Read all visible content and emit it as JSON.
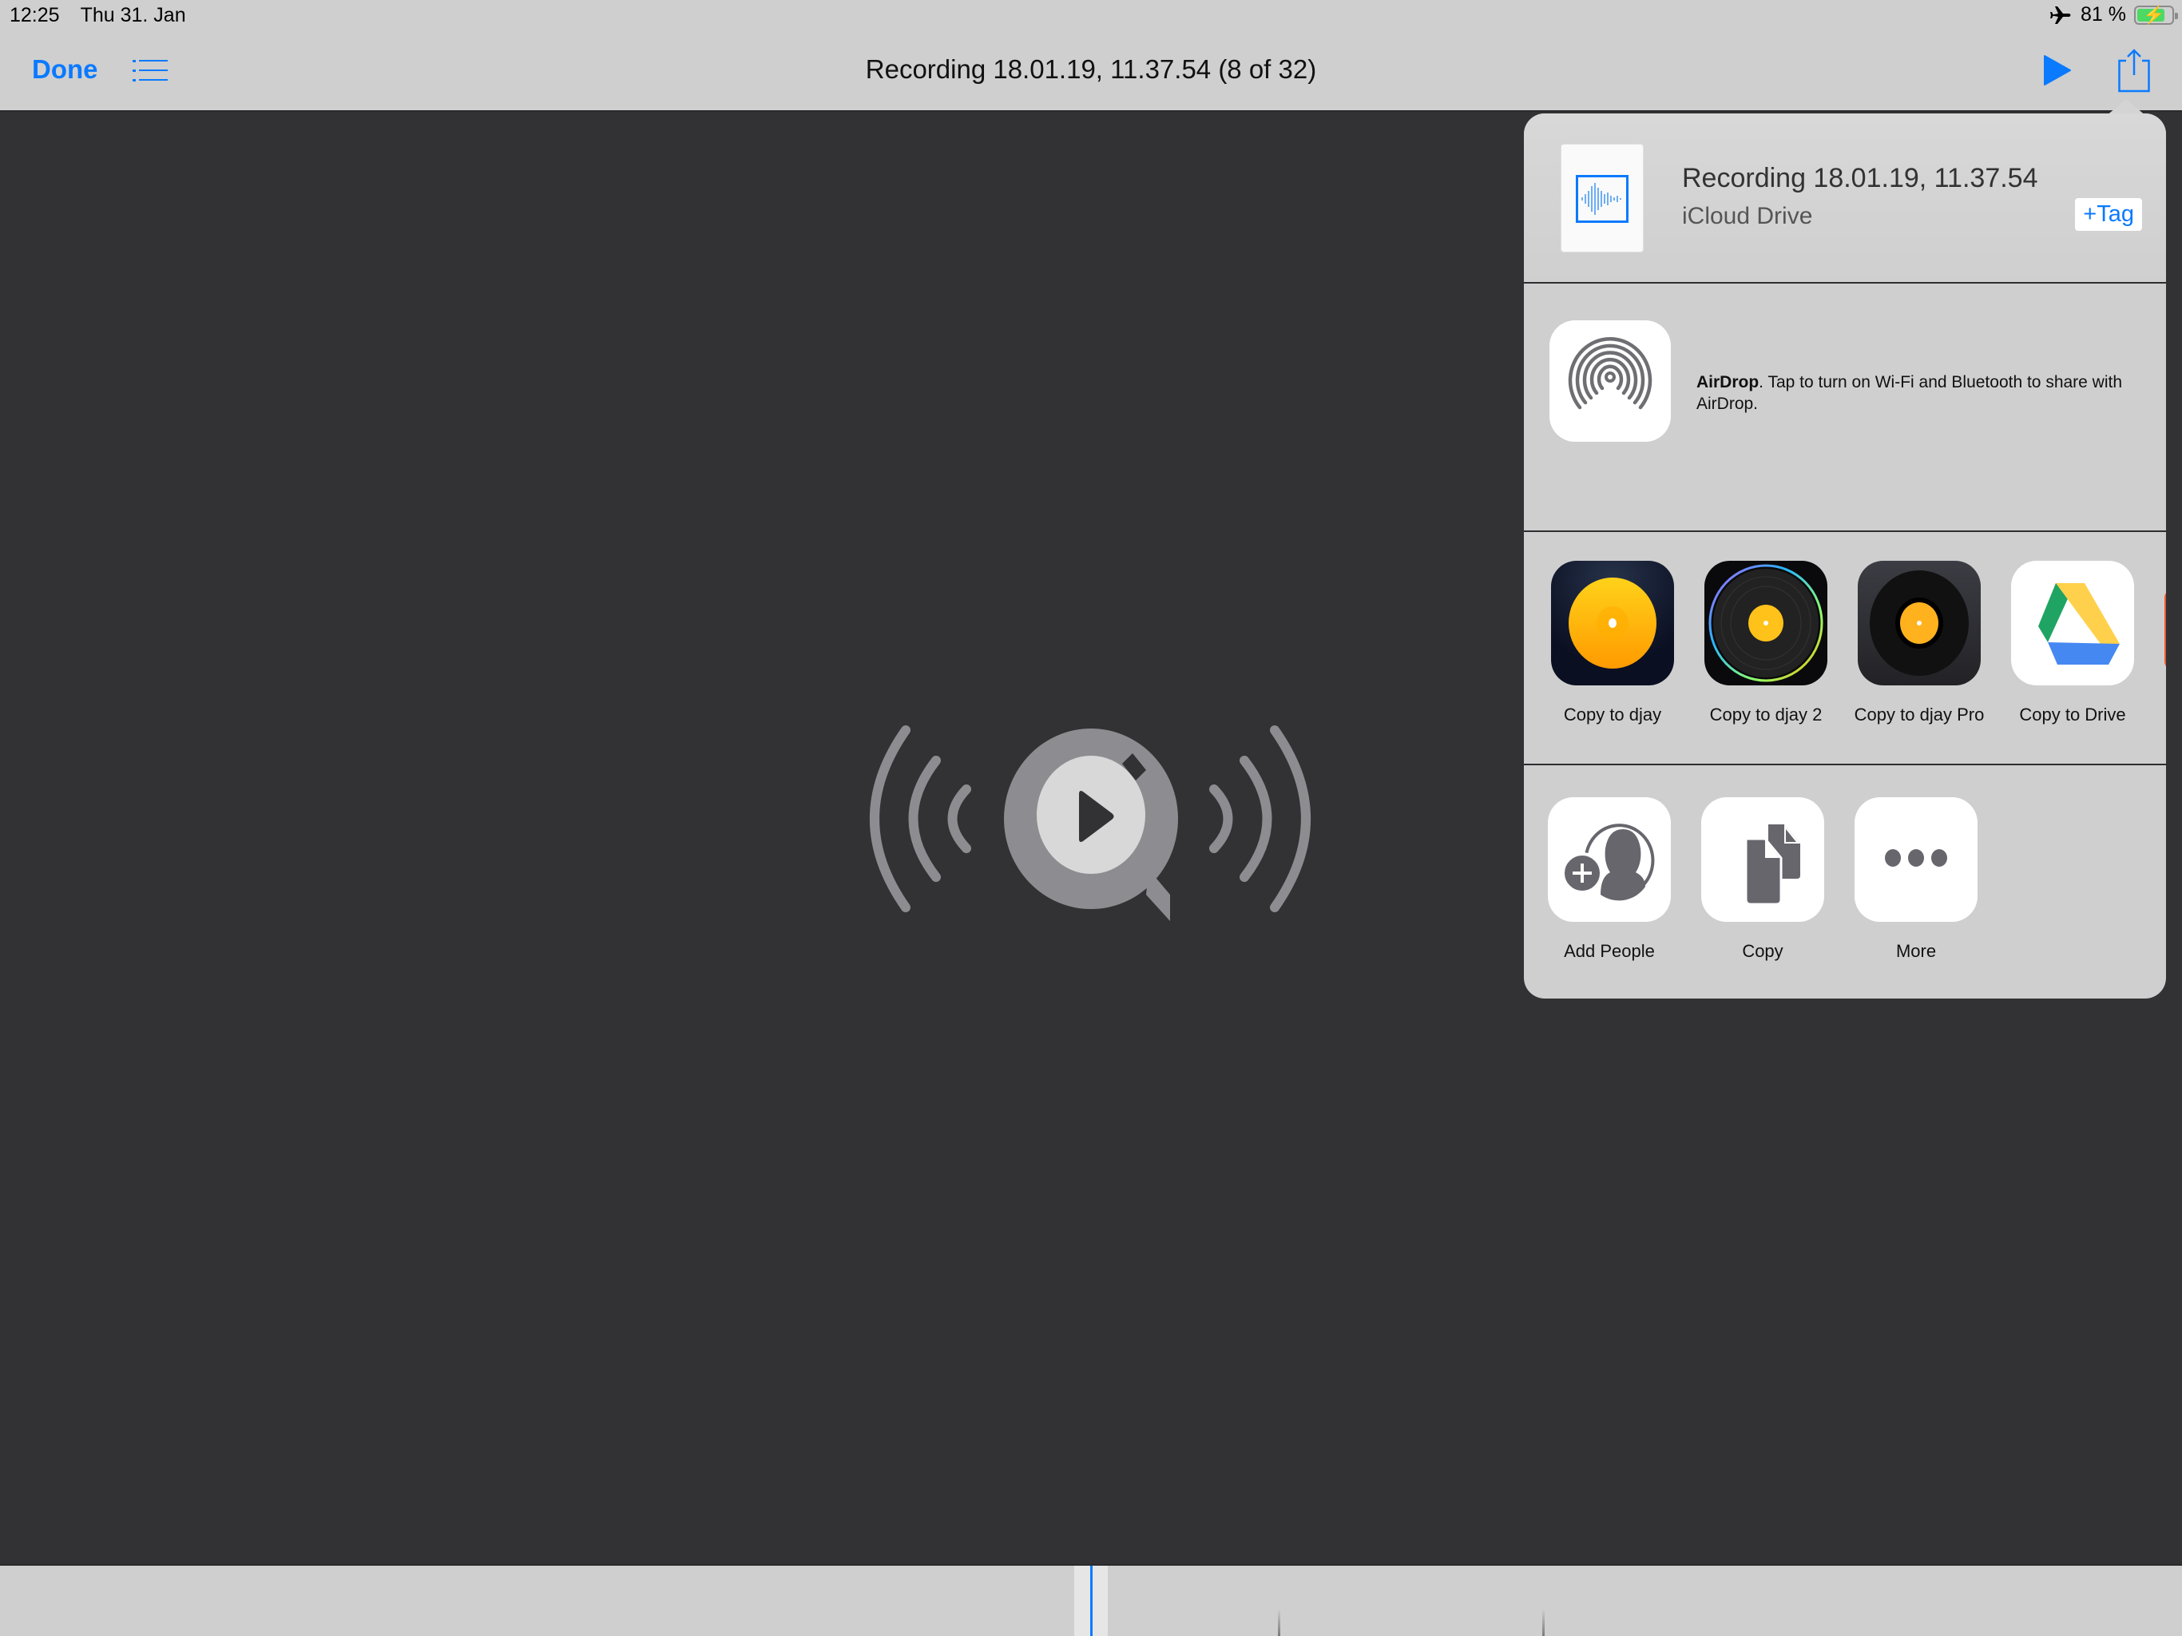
{
  "status_bar": {
    "time": "12:25",
    "date": "Thu 31. Jan",
    "airplane_icon": "airplane-icon",
    "battery_percent": "81 %",
    "battery_level": 0.81,
    "charging": true
  },
  "nav": {
    "done_label": "Done",
    "list_icon": "list-icon",
    "title": "Recording 18.01.19, 11.37.54 (8 of 32)",
    "play_icon": "play-icon",
    "share_icon": "share-icon"
  },
  "preview": {
    "icon": "quicktime-audio-icon"
  },
  "share_sheet": {
    "file": {
      "name": "Recording 18.01.19, 11.37.54",
      "location": "iCloud Drive",
      "tag_label": "+Tag",
      "thumbnail_icon": "waveform-icon"
    },
    "airdrop": {
      "title": "AirDrop",
      "message": ". Tap to turn on Wi-Fi and Bluetooth to share with AirDrop.",
      "icon": "airdrop-icon"
    },
    "apps": [
      {
        "label": "Copy to djay",
        "icon": "djay-icon"
      },
      {
        "label": "Copy to djay 2",
        "icon": "djay2-icon"
      },
      {
        "label": "Copy to djay Pro",
        "icon": "djay-pro-icon"
      },
      {
        "label": "Copy to Drive",
        "icon": "google-drive-icon"
      }
    ],
    "actions": [
      {
        "label": "Add People",
        "icon": "add-people-icon"
      },
      {
        "label": "Copy",
        "icon": "copy-icon"
      },
      {
        "label": "More",
        "icon": "more-icon"
      }
    ]
  },
  "scrubber": {
    "playhead_position": 0.5
  },
  "colors": {
    "accent": "#0a7aff",
    "bar_background": "#cfcfcf",
    "content_background": "#323234",
    "icon_gray": "#66666c"
  }
}
